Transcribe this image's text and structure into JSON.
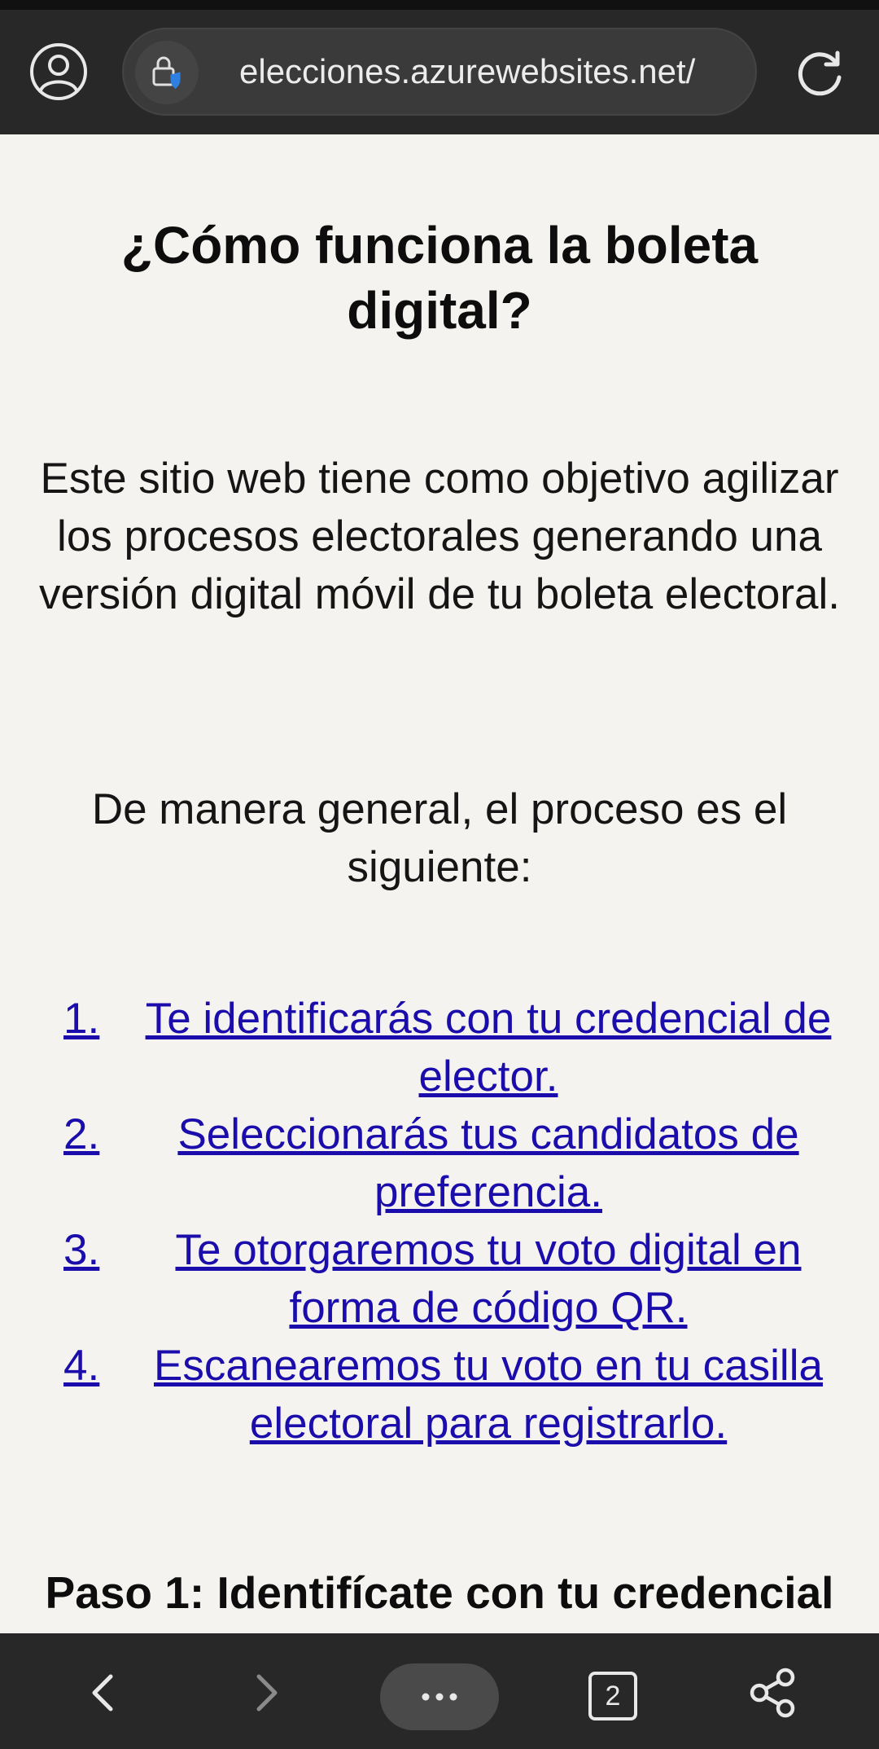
{
  "browser": {
    "url": "elecciones.azurewebsites.net/",
    "tab_count": "2",
    "icons": {
      "profile": "profile-icon",
      "lock": "lock-shield-icon",
      "reload": "reload-icon",
      "back": "back-icon",
      "forward": "forward-icon",
      "menu": "more-icon",
      "tabs": "tabs-icon",
      "share": "share-icon"
    }
  },
  "page": {
    "title": "¿Cómo funciona la boleta digital?",
    "intro": "Este sitio web tiene como objetivo agilizar los procesos electorales generando una versión digital móvil de tu boleta electoral.",
    "general": "De manera general, el proceso es el siguiente:",
    "steps": [
      {
        "num": "1.",
        "text": "Te identificarás con tu credencial de elector."
      },
      {
        "num": "2.",
        "text": "Seleccionarás tus candidatos de preferencia."
      },
      {
        "num": "3.",
        "text": "Te otorgaremos tu voto digital en forma de código QR."
      },
      {
        "num": "4.",
        "text": "Escanearemos tu voto en tu casilla electoral para registrarlo."
      }
    ],
    "paso_heading": "Paso 1: Identifícate con tu credencial"
  },
  "colors": {
    "link": "#1a0dab",
    "chrome": "#282828",
    "page_bg": "#f5f3ef"
  }
}
